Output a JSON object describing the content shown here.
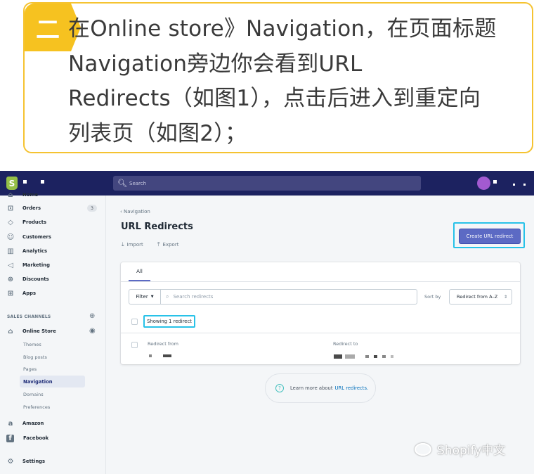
{
  "callout": {
    "badge": "二",
    "text_lines": [
      "在Online store》Navigation，在页面标题",
      "Navigation旁边你会看到URL",
      "Redirects（如图1），点击后进入到重定向",
      "列表页（如图2）；"
    ],
    "border_color": "#f5c331",
    "badge_color": "#f6c220"
  },
  "topbar": {
    "search_placeholder": "Search",
    "bg_color": "#1c2260",
    "logo_glyph": "S"
  },
  "sidebar": {
    "items": [
      {
        "label": "Home",
        "icon": "home-icon"
      },
      {
        "label": "Orders",
        "icon": "orders-icon",
        "count": "3"
      },
      {
        "label": "Products",
        "icon": "tag-icon"
      },
      {
        "label": "Customers",
        "icon": "customers-icon"
      },
      {
        "label": "Analytics",
        "icon": "bar-chart-icon"
      },
      {
        "label": "Marketing",
        "icon": "megaphone-icon"
      },
      {
        "label": "Discounts",
        "icon": "discount-icon"
      },
      {
        "label": "Apps",
        "icon": "apps-icon"
      }
    ],
    "sales_channels_label": "SALES CHANNELS",
    "online_store_label": "Online Store",
    "online_store_sub": [
      "Themes",
      "Blog posts",
      "Pages",
      "Navigation",
      "Domains",
      "Preferences"
    ],
    "active_sub": "Navigation",
    "channels": [
      {
        "label": "Amazon",
        "icon": "amazon-icon"
      },
      {
        "label": "Facebook",
        "icon": "facebook-icon"
      }
    ],
    "settings_label": "Settings"
  },
  "main": {
    "breadcrumb": "Navigation",
    "title": "URL Redirects",
    "import_label": "Import",
    "export_label": "Export",
    "create_button": "Create URL redirect",
    "tab_all": "All",
    "filter_label": "Filter",
    "search_placeholder": "Search redirects",
    "sort_label": "Sort by",
    "sort_value": "Redirect from A–Z",
    "showing_label": "Showing 1 redirect",
    "col_from": "Redirect from",
    "col_to": "Redirect to",
    "learn_text": "Learn more about",
    "learn_link": "URL redirects.",
    "accent_color": "#5c6ac4",
    "highlight_color": "#28c2e8"
  },
  "watermark": "Shopify中文"
}
